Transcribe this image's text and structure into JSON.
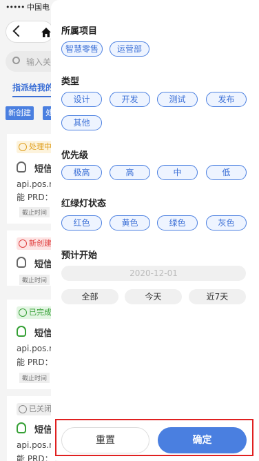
{
  "background": {
    "status_carrier": "中国电",
    "search_placeholder": "输入关",
    "tab_label": "指派给我的",
    "btn_new": "新创建",
    "btn_other": "处",
    "cards": [
      {
        "badge": "处理中",
        "badge_color": "#e0a020",
        "title": "短信",
        "api": "api.pos.n",
        "prd": "能 PRD：",
        "deadline": "截止时间",
        "bulb_color": "#666"
      },
      {
        "badge": "新创建",
        "badge_color": "#e04040",
        "title": "短信",
        "api": "",
        "prd": "",
        "deadline": "截止时间",
        "bulb_color": "#666"
      },
      {
        "badge": "已完成",
        "badge_color": "#35a035",
        "title": "短信",
        "api": "api.pos.n",
        "prd": "能 PRD：",
        "deadline": "截止时间",
        "bulb_color": "#35a035"
      },
      {
        "badge": "已关闭",
        "badge_color": "#888",
        "title": "短信",
        "api": "api.pos.n",
        "prd": "能 PRD：",
        "deadline": "",
        "bulb_color": "#35a035"
      }
    ]
  },
  "filter": {
    "project": {
      "title": "所属项目",
      "options": [
        "智慧零售",
        "运营部"
      ]
    },
    "type": {
      "title": "类型",
      "options": [
        "设计",
        "开发",
        "测试",
        "发布",
        "其他"
      ]
    },
    "priority": {
      "title": "优先级",
      "options": [
        "极高",
        "高",
        "中",
        "低"
      ]
    },
    "light": {
      "title": "红绿灯状态",
      "options": [
        "红色",
        "黄色",
        "绿色",
        "灰色"
      ]
    },
    "start": {
      "title": "预计开始",
      "date_placeholder": "2020-12-01",
      "quick": [
        "全部",
        "今天",
        "近7天"
      ]
    },
    "reset_label": "重置",
    "confirm_label": "确定"
  },
  "colors": {
    "accent": "#4a7fe0",
    "highlight_border": "#e02020"
  }
}
